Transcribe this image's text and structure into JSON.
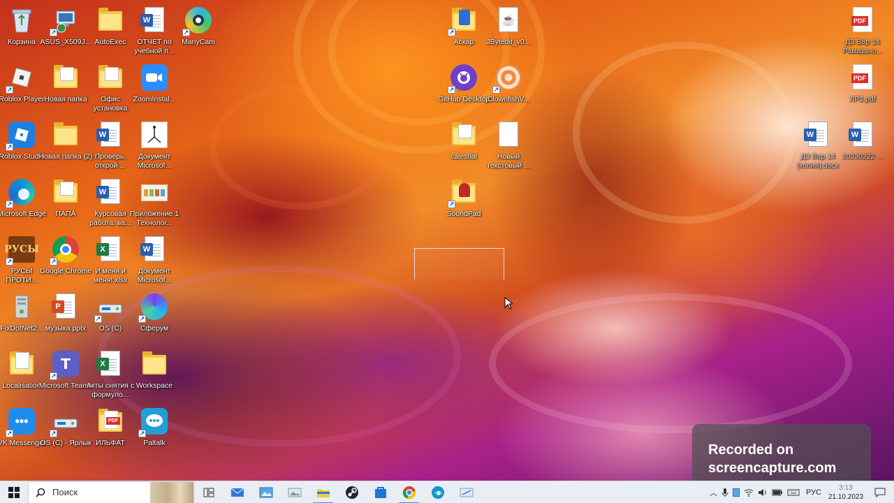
{
  "desktop": {
    "icons": [
      {
        "label": "Корзина"
      },
      {
        "label": "ASUS_X509J..."
      },
      {
        "label": "AutoExec"
      },
      {
        "label": "ОТЧЕТ по учебной п..."
      },
      {
        "label": "ManyCam"
      },
      {
        "label": "Roblox Player"
      },
      {
        "label": "Новая папка"
      },
      {
        "label": "Офис установка"
      },
      {
        "label": "ZoomInstal..."
      },
      {
        "label": "Roblox Studio"
      },
      {
        "label": "Новая папка (2)"
      },
      {
        "label": "Проверь, открой ..."
      },
      {
        "label": "Документ Microsof..."
      },
      {
        "label": "Microsoft Edge"
      },
      {
        "label": "ПАПА"
      },
      {
        "label": "Курсовая работа. ва..."
      },
      {
        "label": "Приложение 1 Технолог..."
      },
      {
        "label": "РУСЫ ПРОТИ..."
      },
      {
        "label": "Google Chrome"
      },
      {
        "label": "И меня и меня!.xlsx"
      },
      {
        "label": "Документ Microsof..."
      },
      {
        "label": "FixDotNet2..."
      },
      {
        "label": "музыка.pptx"
      },
      {
        "label": "OS (C)"
      },
      {
        "label": "Сферум"
      },
      {
        "label": "Localisation"
      },
      {
        "label": "Microsoft Teams"
      },
      {
        "label": "Акты снятия с формуло..."
      },
      {
        "label": "Workspace"
      },
      {
        "label": "VK Messenger"
      },
      {
        "label": "OS (C) - Ярлык"
      },
      {
        "label": "ИЛЬФАТ"
      },
      {
        "label": "Paltalk"
      },
      {
        "label": "Аскар"
      },
      {
        "label": "JBytedit_v0..."
      },
      {
        "label": "GitHub Desktop"
      },
      {
        "label": "ClownfishV..."
      },
      {
        "label": "calestial"
      },
      {
        "label": "Новый текстовый ..."
      },
      {
        "label": "SoundPad"
      },
      {
        "label": "ДЗ Вар 14 Рамазано..."
      },
      {
        "label": "ЛР2.pdf"
      },
      {
        "label": "ДЗ Вар 14 (копия).docx"
      },
      {
        "label": "20230222 ..."
      }
    ],
    "watermark": {
      "line1": "Recorded on",
      "line2": "screencapture.com"
    }
  },
  "taskbar": {
    "search_placeholder": "Поиск",
    "apps": [
      {
        "icon": "task-view-icon"
      },
      {
        "icon": "mail-icon"
      },
      {
        "icon": "photos-icon"
      },
      {
        "icon": "image-viewer-icon"
      },
      {
        "icon": "file-explorer-icon"
      },
      {
        "icon": "steam-icon"
      },
      {
        "icon": "store-icon"
      },
      {
        "icon": "google-chrome-icon"
      },
      {
        "icon": "microsoft-edge-icon"
      },
      {
        "icon": "snipping-icon"
      }
    ],
    "tray": {
      "language": "РУС",
      "time": "3:13",
      "date": "21.10.2023"
    }
  },
  "colors": {
    "taskbar_bg": "#e8eef4",
    "accent": "#4d8fd6"
  }
}
